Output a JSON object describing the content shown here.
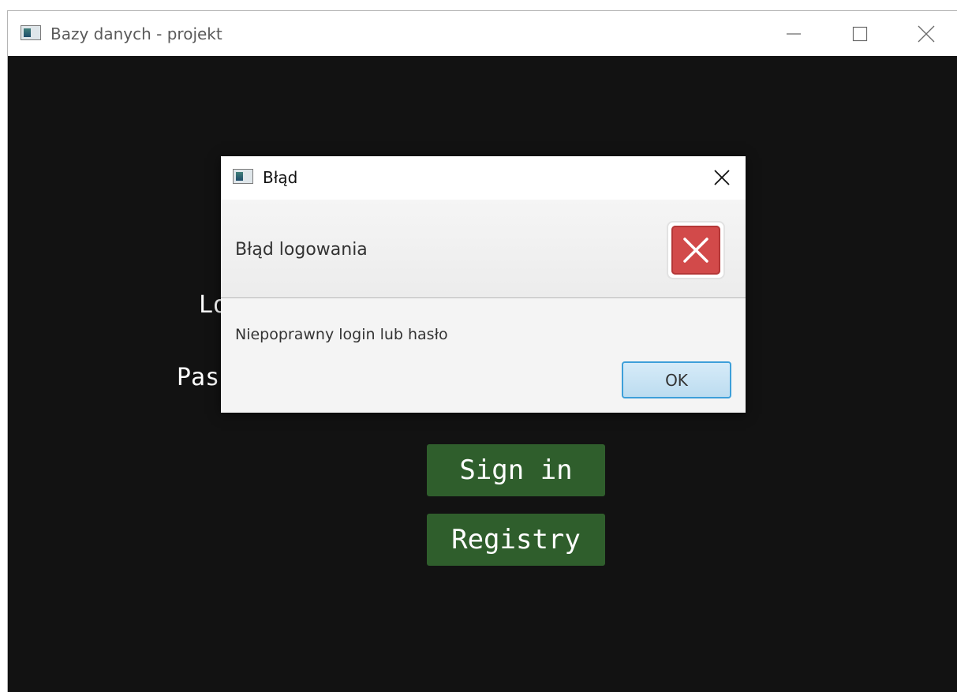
{
  "window": {
    "title": "Bazy danych - projekt",
    "icon": "app-window-icon",
    "controls": [
      "minimize-icon",
      "maximize-icon",
      "close-icon"
    ]
  },
  "login_form": {
    "login_label": "Login:",
    "password_label": "Password:",
    "sign_in_label": "Sign in",
    "registry_label": "Registry",
    "button_color": "#2f5e2c",
    "background_color": "#121212"
  },
  "dialog": {
    "title": "Błąd",
    "header_text": "Błąd logowania",
    "message": "Niepoprawny login lub hasło",
    "ok_label": "OK",
    "icon": "error-icon",
    "error_color": "#d24a4a",
    "ok_border_color": "#3d9fd9"
  }
}
